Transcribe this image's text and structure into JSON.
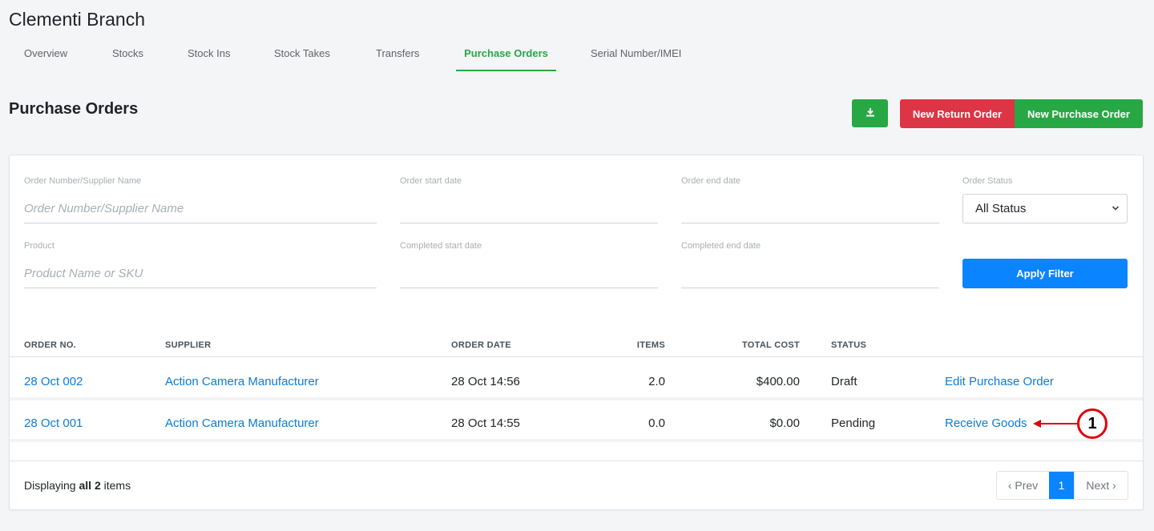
{
  "header": {
    "branch_title": "Clementi Branch"
  },
  "tabs": [
    {
      "label": "Overview"
    },
    {
      "label": "Stocks"
    },
    {
      "label": "Stock Ins"
    },
    {
      "label": "Stock Takes"
    },
    {
      "label": "Transfers"
    },
    {
      "label": "Purchase Orders",
      "active": true
    },
    {
      "label": "Serial Number/IMEI"
    }
  ],
  "page": {
    "title": "Purchase Orders"
  },
  "actions": {
    "download_icon": "download-icon",
    "new_return_order": "New Return Order",
    "new_purchase_order": "New Purchase Order"
  },
  "filters": {
    "order_number_label": "Order Number/Supplier Name",
    "order_number_placeholder": "Order Number/Supplier Name",
    "order_start_label": "Order start date",
    "order_end_label": "Order end date",
    "order_status_label": "Order Status",
    "order_status_value": "All Status",
    "product_label": "Product",
    "product_placeholder": "Product Name or SKU",
    "completed_start_label": "Completed start date",
    "completed_end_label": "Completed end date",
    "apply_label": "Apply Filter"
  },
  "table": {
    "headers": [
      "ORDER NO.",
      "SUPPLIER",
      "ORDER DATE",
      "ITEMS",
      "TOTAL COST",
      "STATUS"
    ],
    "rows": [
      {
        "order_no": "28 Oct 002",
        "supplier": "Action Camera Manufacturer",
        "order_date": "28 Oct 14:56",
        "items": "2.0",
        "total_cost": "$400.00",
        "status": "Draft",
        "action": "Edit Purchase Order"
      },
      {
        "order_no": "28 Oct 001",
        "supplier": "Action Camera Manufacturer",
        "order_date": "28 Oct 14:55",
        "items": "0.0",
        "total_cost": "$0.00",
        "status": "Pending",
        "action": "Receive Goods"
      }
    ]
  },
  "footer": {
    "displaying_prefix": "Displaying ",
    "displaying_bold": "all 2",
    "displaying_suffix": " items"
  },
  "pagination": {
    "prev": "‹ Prev",
    "current": "1",
    "next": "Next ›"
  },
  "callout": {
    "number": "1"
  },
  "colors": {
    "accent_green": "#28a745",
    "danger_red": "#dc3545",
    "primary_blue": "#0a84ff",
    "link_blue": "#0a7cd8",
    "callout_red": "#e0000a"
  }
}
